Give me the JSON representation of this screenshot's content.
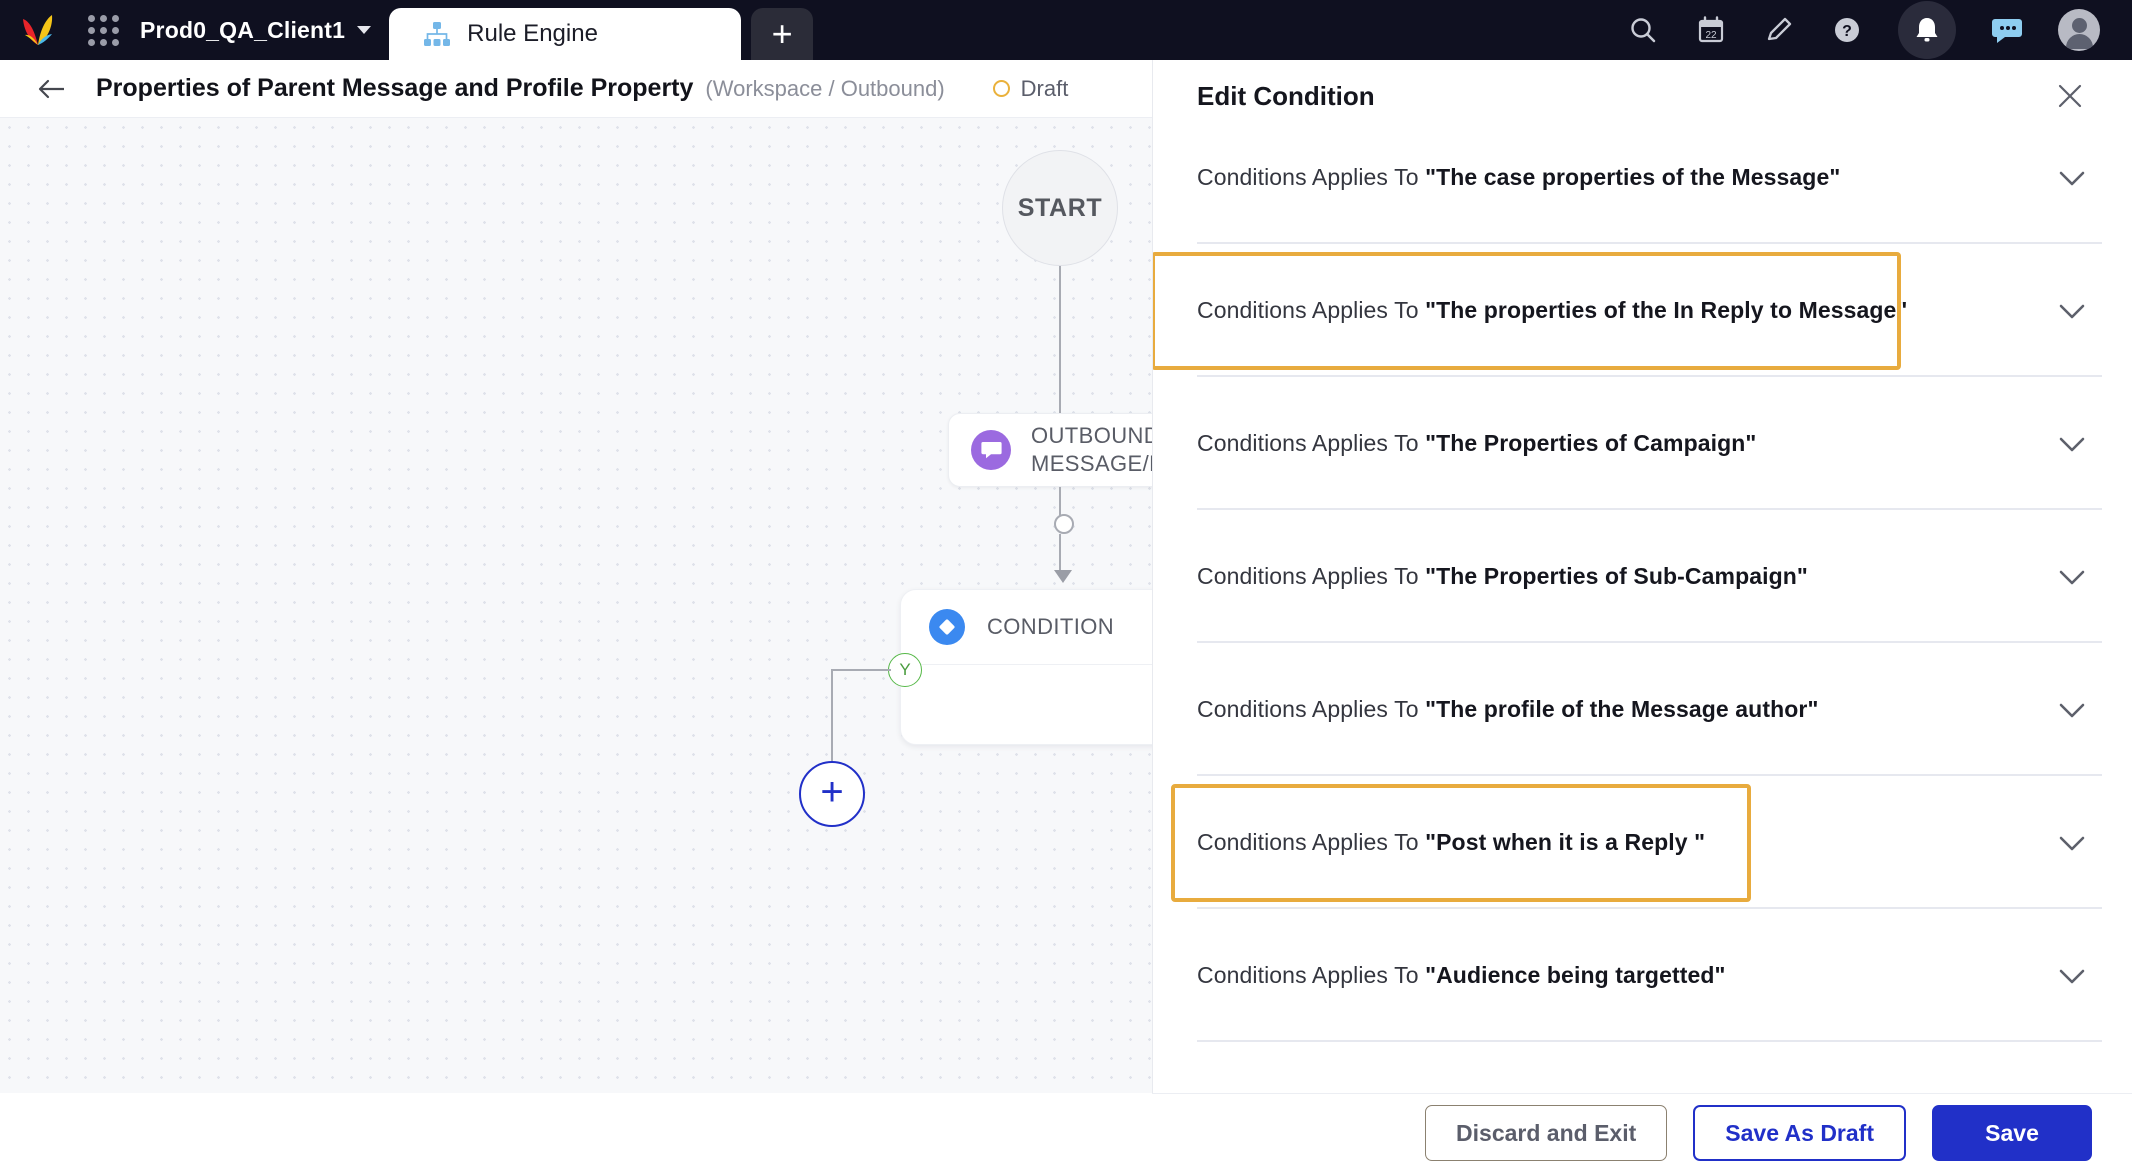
{
  "topnav": {
    "logo_icon": "sprinklr-logo",
    "app_launcher_icon": "app-grid-icon",
    "client_name": "Prod0_QA_Client1",
    "client_chevron_icon": "chevron-down-icon",
    "tab": {
      "icon": "rule-engine-hierarchy-icon",
      "label": "Rule Engine"
    },
    "add_tab_label": "+",
    "icons": [
      {
        "name": "search-icon",
        "glyph": "search"
      },
      {
        "name": "calendar-icon",
        "glyph": "calendar",
        "day": "22"
      },
      {
        "name": "edit-pencil-icon",
        "glyph": "pencil"
      },
      {
        "name": "help-icon",
        "glyph": "question"
      },
      {
        "name": "notifications-bell-icon",
        "glyph": "bell"
      },
      {
        "name": "messages-chat-icon",
        "glyph": "chat"
      },
      {
        "name": "user-avatar",
        "glyph": "avatar"
      }
    ]
  },
  "subheader": {
    "back_icon": "back-arrow-icon",
    "title": "Properties of Parent Message and Profile Property",
    "scope": "(Workspace / Outbound)",
    "status": "Draft",
    "status_color": "#eab13b"
  },
  "canvas": {
    "start_node_label": "START",
    "outbound_node_label": "OUTBOUND MESSAGE/POST",
    "outbound_node_icon": "outbound-message-icon",
    "condition_node_label": "CONDITION",
    "condition_node_icon": "condition-diamond-icon",
    "branch_yes_label": "Y",
    "add_node_label": "+"
  },
  "panel": {
    "title": "Edit Condition",
    "close_icon": "close-icon",
    "row_prefix": "Conditions Applies To ",
    "chevron_icon": "chevron-down-icon",
    "rows": [
      {
        "name": "\"The case properties of the Message\"",
        "highlighted": false
      },
      {
        "name": "\"The properties of the In Reply to Message\"",
        "highlighted": true
      },
      {
        "name": "\"The Properties of Campaign\"",
        "highlighted": false
      },
      {
        "name": "\"The Properties of Sub-Campaign\"",
        "highlighted": false
      },
      {
        "name": "\"The profile of the Message author\"",
        "highlighted": false
      },
      {
        "name": "\"Post when it is a Reply \"",
        "highlighted": true
      },
      {
        "name": "\"Audience being targetted\"",
        "highlighted": false
      }
    ],
    "highlight_color": "#e8ab3e"
  },
  "footer": {
    "discard_label": "Discard and Exit",
    "save_draft_label": "Save As Draft",
    "save_label": "Save",
    "primary_color": "#2130c8"
  }
}
